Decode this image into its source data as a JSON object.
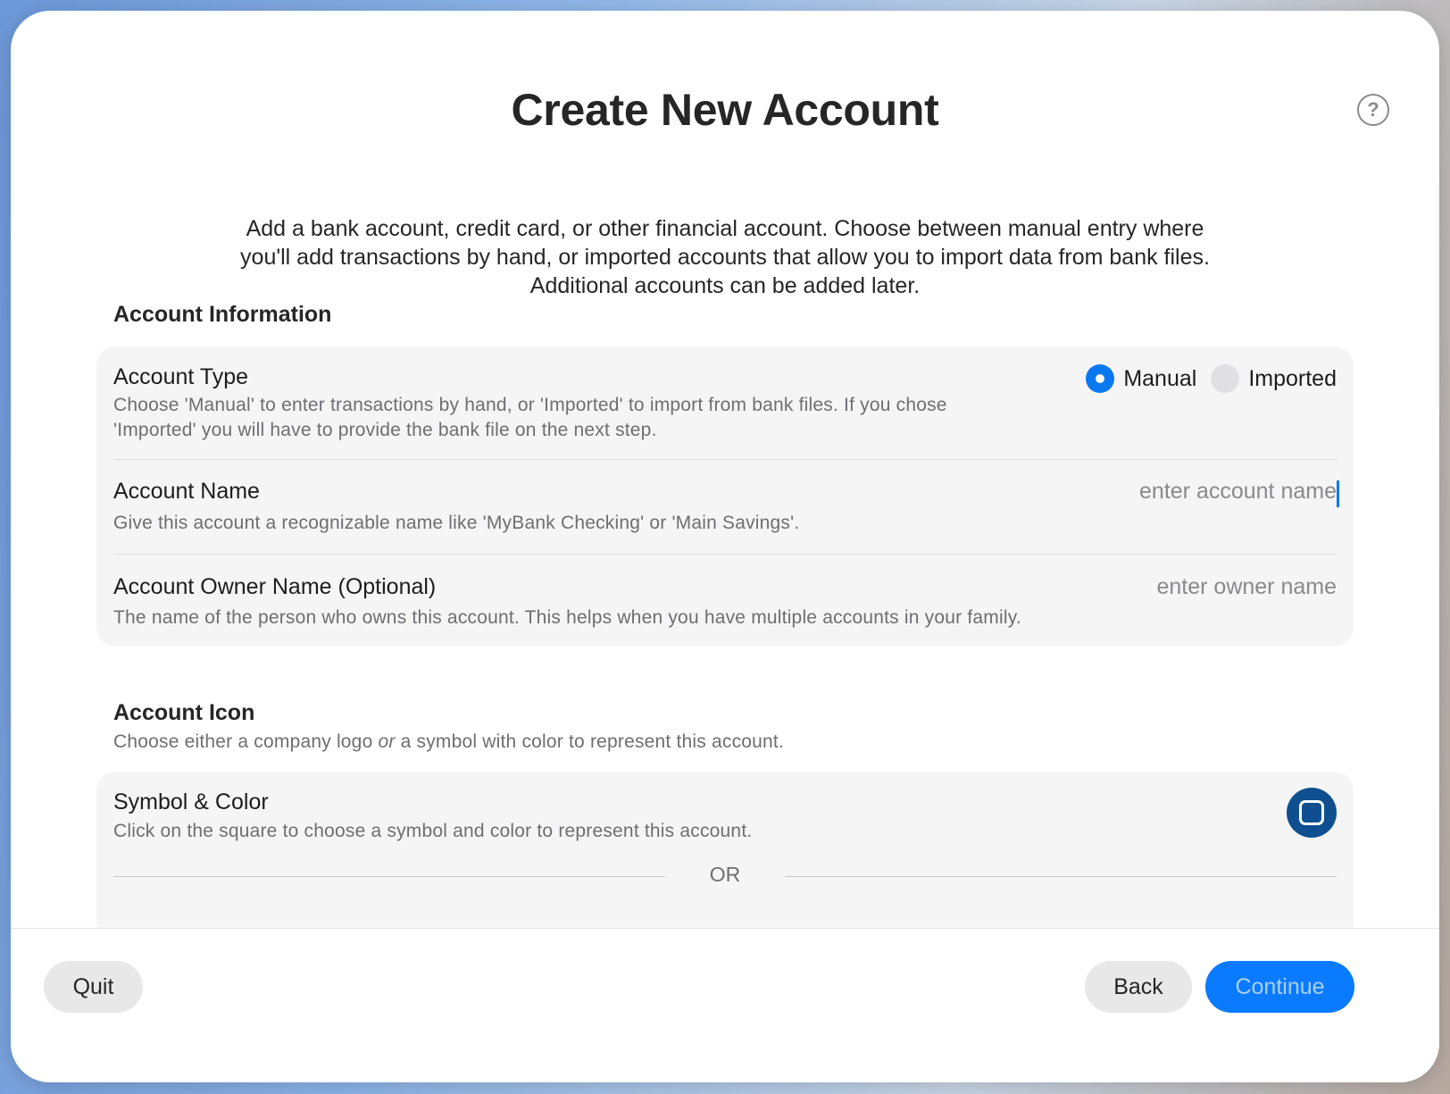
{
  "header": {
    "title": "Create New Account",
    "help_icon": "question-circle-icon",
    "help_glyph": "?"
  },
  "intro": {
    "line1": "Add a bank account, credit card, or other financial account. Choose between manual entry where",
    "line2": "you'll add transactions by hand, or imported accounts that allow you to import data from bank files.",
    "line3": "Additional accounts can be added later."
  },
  "account_info": {
    "heading": "Account Information",
    "account_type": {
      "title": "Account Type",
      "desc1": "Choose 'Manual' to enter transactions by hand, or 'Imported' to import from bank files. If you chose",
      "desc2": "'Imported' you will have to provide the bank file on the next step.",
      "options": [
        "Manual",
        "Imported"
      ],
      "selected": "Manual"
    },
    "account_name": {
      "title": "Account Name",
      "desc": "Give this account a recognizable name like 'MyBank Checking' or 'Main Savings'.",
      "placeholder": "enter account name",
      "value": ""
    },
    "owner_name": {
      "title": "Account Owner Name (Optional)",
      "desc": "The name of the person who owns this account. This helps when you have multiple accounts in your family.",
      "placeholder": "enter owner name",
      "value": ""
    }
  },
  "account_icon": {
    "heading": "Account Icon",
    "sub_a": "Choose either a company logo ",
    "sub_em": "or",
    "sub_b": " a symbol with color to represent this account.",
    "symbol_color": {
      "title": "Symbol & Color",
      "desc": "Click on the square to choose a symbol and color to represent this account.",
      "button_icon": "rounded-square-icon",
      "button_color": "#0f4f8f"
    },
    "or_label": "OR"
  },
  "footer": {
    "quit_label": "Quit",
    "back_label": "Back",
    "continue_label": "Continue"
  },
  "colors": {
    "accent": "#0a7bff",
    "continue_text": "#a9d0ff"
  }
}
